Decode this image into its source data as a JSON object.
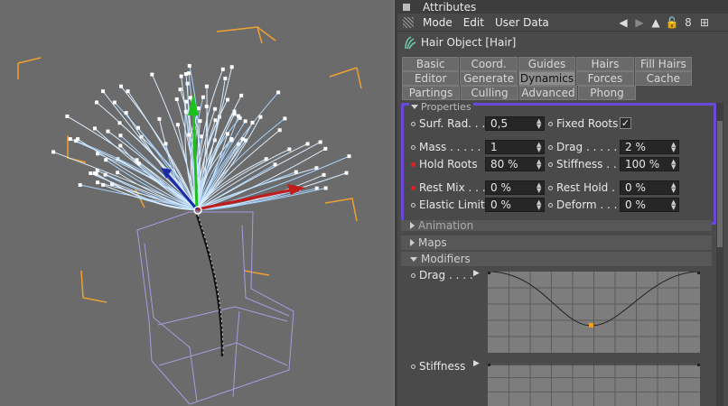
{
  "window": {
    "title": "Attributes"
  },
  "menu": {
    "mode": "Mode",
    "edit": "Edit",
    "user_data": "User Data"
  },
  "object": {
    "name": "Hair Object [Hair]"
  },
  "tabs": {
    "row1": [
      "Basic",
      "Coord.",
      "Guides",
      "Hairs",
      "Fill Hairs"
    ],
    "row2": [
      "Editor",
      "Generate",
      "Dynamics",
      "Forces",
      "Cache"
    ],
    "row3": [
      "Partings",
      "Culling",
      "Advanced",
      "Phong"
    ],
    "active": "Dynamics"
  },
  "properties": {
    "header": "Properties",
    "surf_rad": {
      "label": "Surf. Rad. . .",
      "value": "0,5"
    },
    "fixed_roots": {
      "label": "Fixed Roots",
      "checked": true,
      "mark": "✓"
    },
    "mass": {
      "label": "Mass . . . . .",
      "value": "1"
    },
    "drag": {
      "label": "Drag . . . . .",
      "value": "2 %"
    },
    "hold_roots": {
      "label": "Hold Roots",
      "value": "80 %"
    },
    "stiffness": {
      "label": "Stiffness . . .",
      "value": "100 %"
    },
    "rest_mix": {
      "label": "Rest Mix . . .",
      "value": "0 %"
    },
    "rest_hold": {
      "label": "Rest Hold . .",
      "value": "0 %"
    },
    "elastic_limit": {
      "label": "Elastic Limit",
      "value": "0 %"
    },
    "deform": {
      "label": "Deform . . . .",
      "value": "0 %"
    }
  },
  "sections": {
    "animation": "Animation",
    "maps": "Maps",
    "modifiers": "Modifiers"
  },
  "modifiers": {
    "drag_label": "Drag . . . .",
    "stiffness_label": "Stiffness"
  },
  "colors": {
    "highlight_border": "#6a49d6",
    "animated_dot": "#e02020",
    "hair": "#cfe6ff",
    "cage": "#f0a030"
  }
}
